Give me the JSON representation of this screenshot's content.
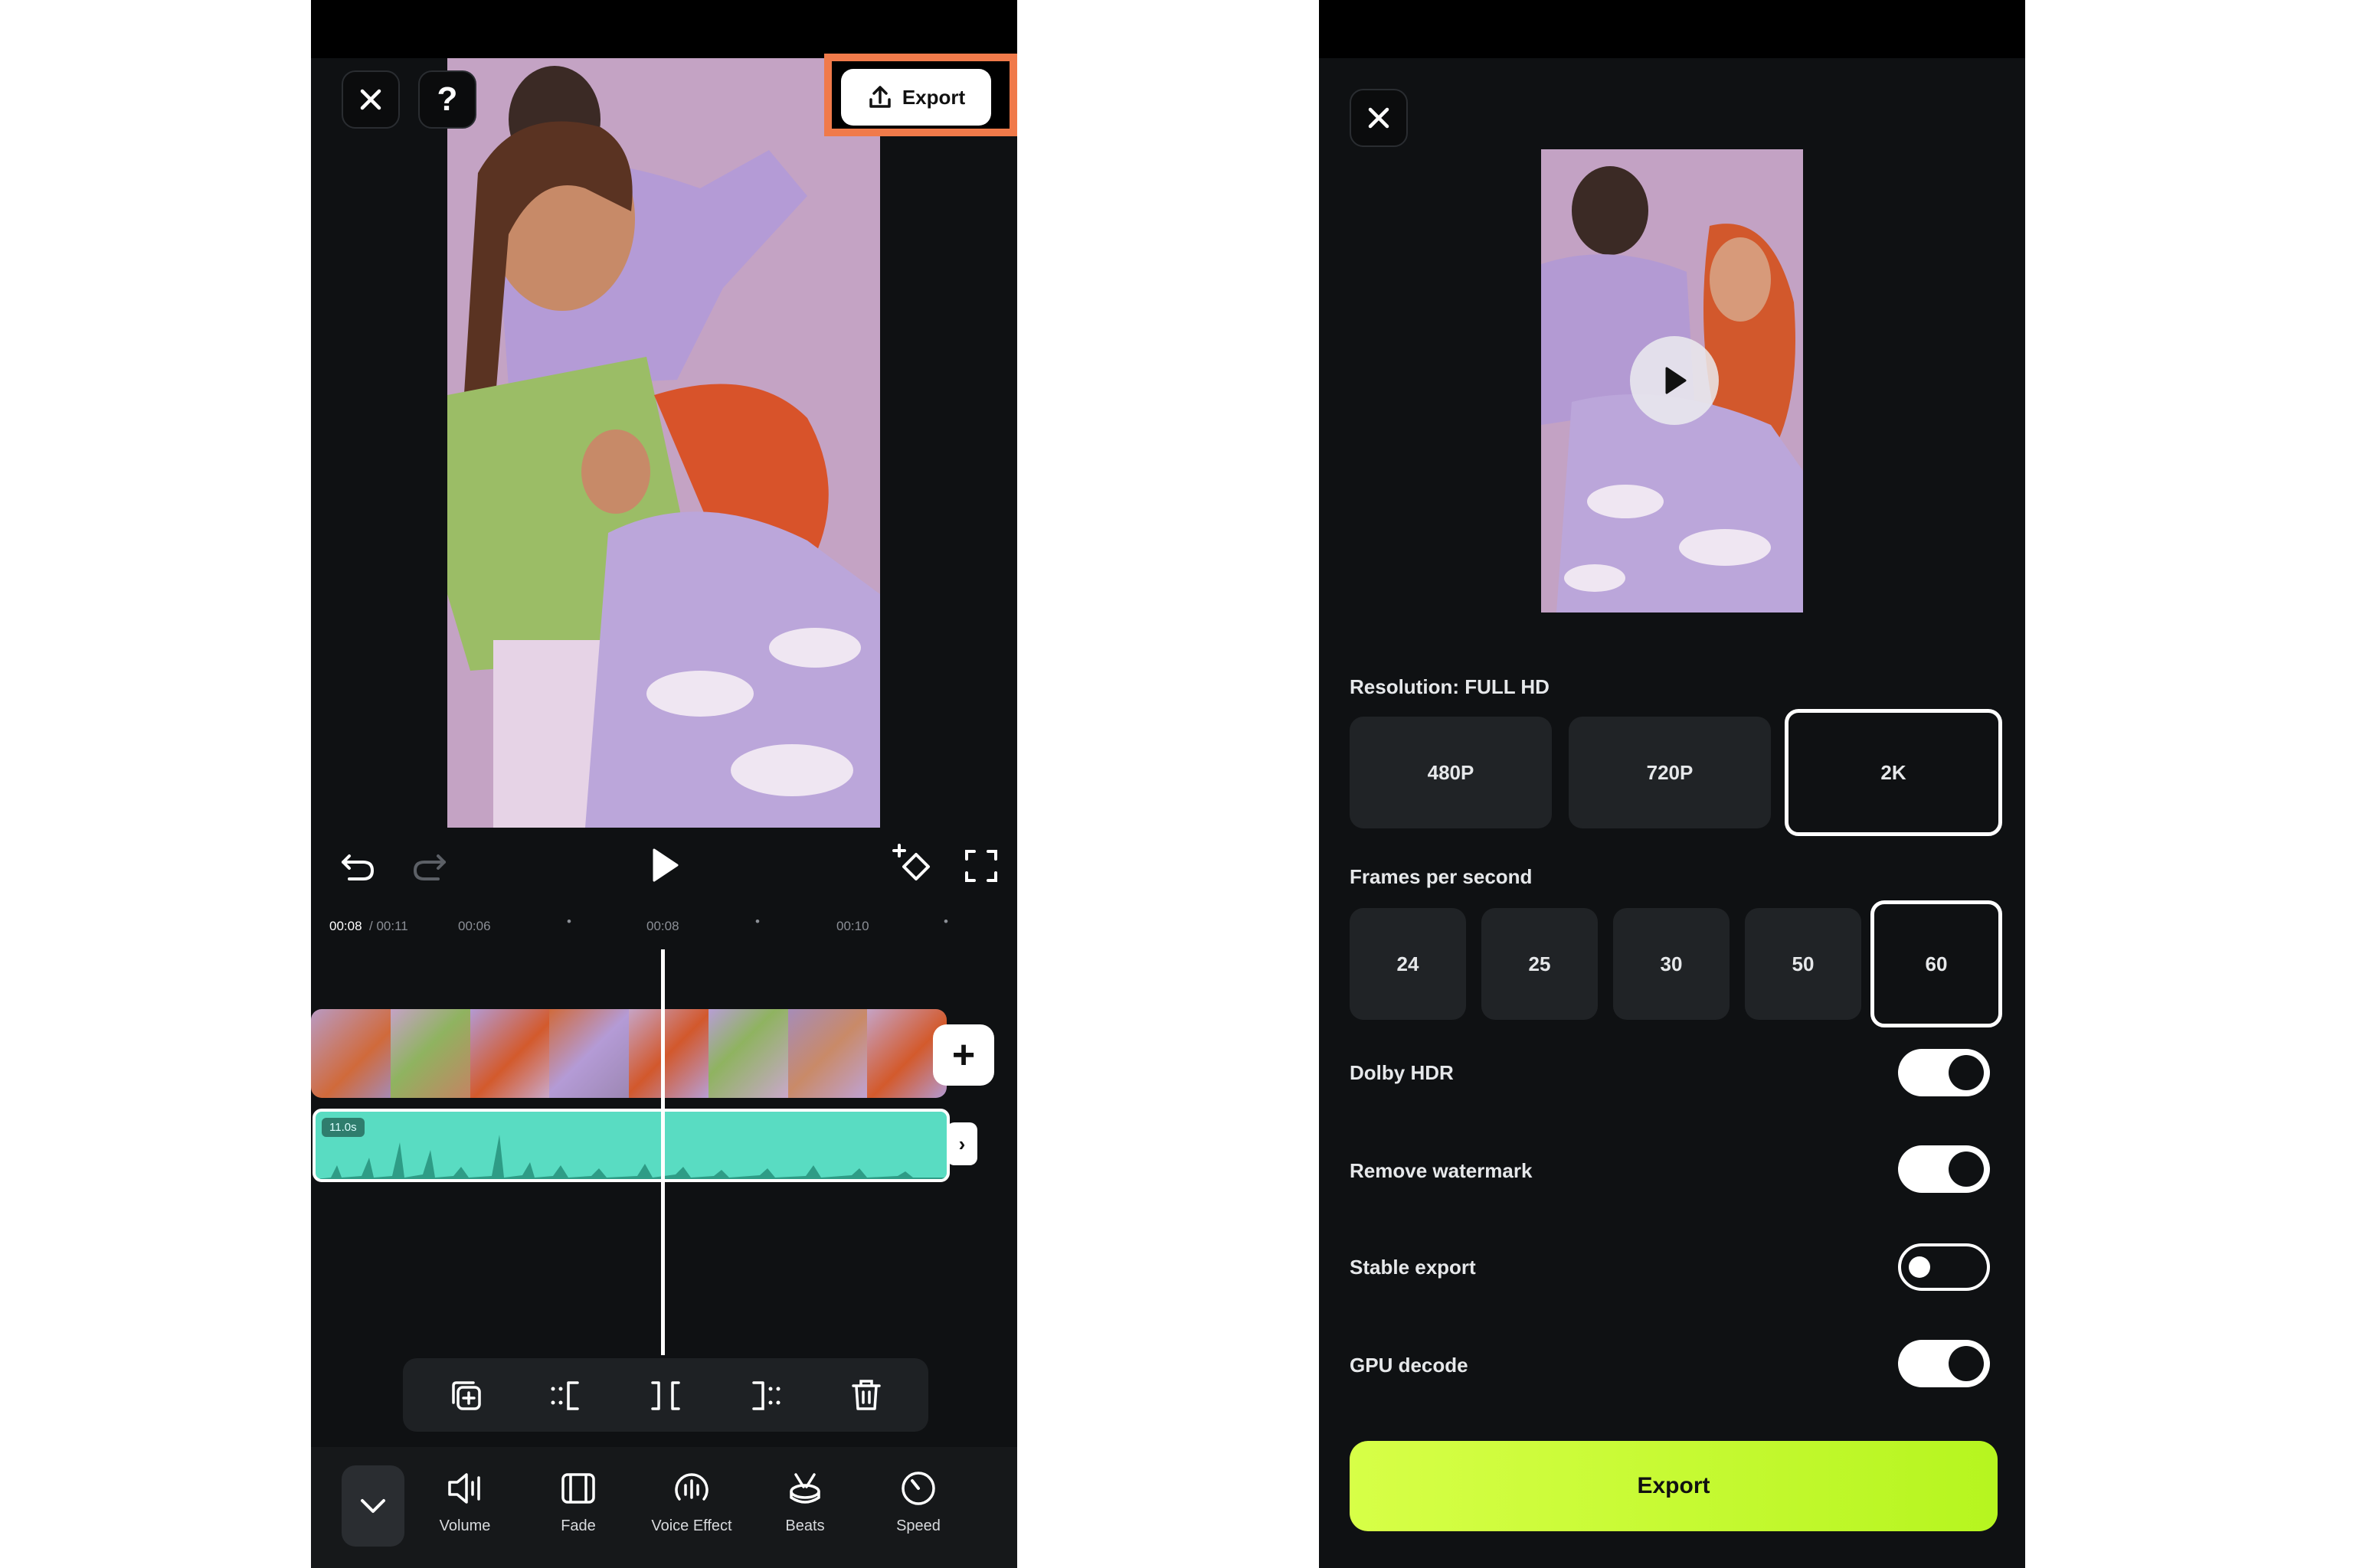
{
  "editor": {
    "export_label": "Export",
    "timecode_current": "00:08",
    "timecode_total": "/ 00:11",
    "ruler_ticks": [
      "00:06",
      "00:08",
      "00:10"
    ],
    "audio_duration": "11.0s",
    "tools": [
      {
        "label": "Volume",
        "icon": "volume-icon"
      },
      {
        "label": "Fade",
        "icon": "fade-icon"
      },
      {
        "label": "Voice Effect",
        "icon": "voice-effect-icon"
      },
      {
        "label": "Beats",
        "icon": "beats-icon"
      },
      {
        "label": "Speed",
        "icon": "speed-icon"
      }
    ],
    "highlight_color": "#f07a4a",
    "audio_color": "#59dcc2"
  },
  "export_panel": {
    "resolution_label": "Resolution: FULL HD",
    "resolutions": [
      "480P",
      "720P",
      "2K"
    ],
    "selected_resolution": "2K",
    "fps_label": "Frames per second",
    "fps_options": [
      "24",
      "25",
      "30",
      "50",
      "60"
    ],
    "selected_fps": "60",
    "toggles": [
      {
        "label": "Dolby HDR",
        "on": true
      },
      {
        "label": "Remove watermark",
        "on": true
      },
      {
        "label": "Stable export",
        "on": false
      },
      {
        "label": "GPU decode",
        "on": true
      }
    ],
    "export_label": "Export",
    "accent_color": "#c6fb32"
  }
}
